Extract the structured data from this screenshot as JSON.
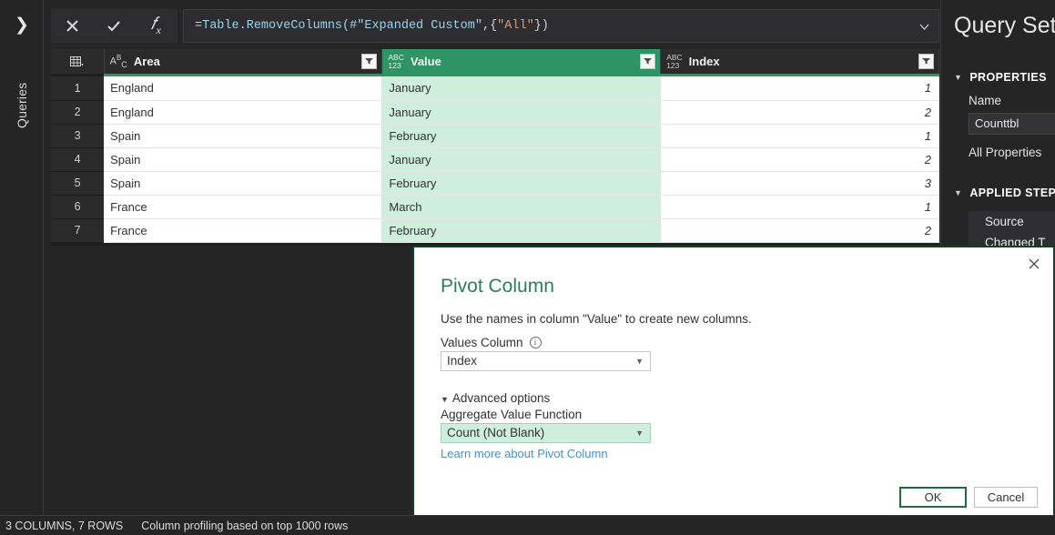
{
  "left_rail": {
    "expand_icon": "chevron-right-icon",
    "label": "Queries"
  },
  "formula_bar": {
    "cancel_icon": "close-icon",
    "commit_icon": "check-icon",
    "function_icon": "fx-icon",
    "formula_prefix": "= ",
    "formula_fn": "Table.RemoveColumns(",
    "formula_arg1": "#\"Expanded Custom\"",
    "formula_mid": ",{",
    "formula_arg2": "\"All\"",
    "formula_end": "})",
    "formula_full": "= Table.RemoveColumns(#\"Expanded Custom\",{\"All\"})",
    "expand_icon": "chevron-down-icon"
  },
  "grid": {
    "corner_icon": "select-all-table-icon",
    "columns": [
      {
        "name": "Area",
        "type_icon": "abc-text-icon",
        "type_top": "A",
        "type_sup": "B",
        "type_sub": "C",
        "selected": false
      },
      {
        "name": "Value",
        "type_icon": "abc-123-icon",
        "type_top": "ABC",
        "type_bottom": "123",
        "selected": true
      },
      {
        "name": "Index",
        "type_icon": "abc-123-icon",
        "type_top": "ABC",
        "type_bottom": "123",
        "selected": false
      }
    ],
    "rows": [
      {
        "n": "1",
        "area": "England",
        "value": "January",
        "index": "1"
      },
      {
        "n": "2",
        "area": "England",
        "value": "January",
        "index": "2"
      },
      {
        "n": "3",
        "area": "Spain",
        "value": "February",
        "index": "1"
      },
      {
        "n": "4",
        "area": "Spain",
        "value": "January",
        "index": "2"
      },
      {
        "n": "5",
        "area": "Spain",
        "value": "February",
        "index": "3"
      },
      {
        "n": "6",
        "area": "France",
        "value": "March",
        "index": "1"
      },
      {
        "n": "7",
        "area": "France",
        "value": "February",
        "index": "2"
      }
    ]
  },
  "query_settings": {
    "title": "Query Sett",
    "properties_section": "PROPERTIES",
    "name_label": "Name",
    "name_value": "Counttbl",
    "all_properties": "All Properties",
    "applied_steps_section": "APPLIED STEP",
    "steps": [
      {
        "label": "Source"
      },
      {
        "label": "Changed T"
      }
    ]
  },
  "dialog": {
    "close_icon": "close-icon",
    "title": "Pivot Column",
    "subtitle": "Use the names in column \"Value\" to create new columns.",
    "values_column_label": "Values Column",
    "info_icon": "info-icon",
    "values_column_value": "Index",
    "advanced_options": "Advanced options",
    "aggregate_label": "Aggregate Value Function",
    "aggregate_value": "Count (Not Blank)",
    "learn_more": "Learn more about Pivot Column",
    "ok_label": "OK",
    "cancel_label": "Cancel",
    "dropdown_icon": "chevron-down-icon"
  },
  "statusbar": {
    "columns_rows": "3 COLUMNS, 7 ROWS",
    "profiling": "Column profiling based on top 1000 rows"
  },
  "colors": {
    "accent_green": "#2e9463",
    "selected_cell_green": "#cfeedd",
    "dialog_border": "#123f28",
    "title_green": "#2f7d5a",
    "link_blue": "#4a90c4",
    "app_dark": "#252526"
  }
}
